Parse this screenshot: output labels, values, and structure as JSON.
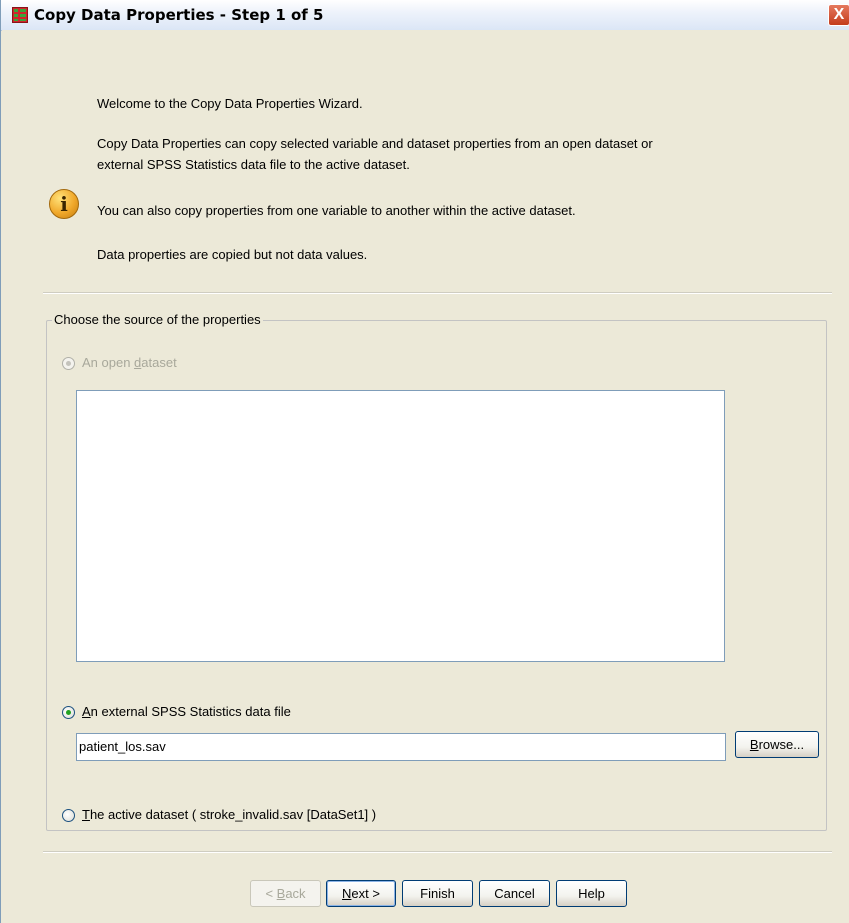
{
  "window": {
    "title": "Copy Data Properties - Step 1 of 5",
    "close_glyph": "X"
  },
  "intro": {
    "welcome": "Welcome to the Copy Data Properties Wizard.",
    "description_line1": "Copy Data Properties can copy selected variable and dataset properties from an open dataset or",
    "description_line2": "external SPSS  Statistics data file to the active dataset.",
    "also_copy": "You can also copy properties from one variable to another within the active dataset.",
    "note": "Data properties are copied but not data values.",
    "info_icon": "info-icon"
  },
  "source_group": {
    "label": "Choose the source of the properties",
    "option_open_dataset": {
      "label_pre": "An open ",
      "label_key": "d",
      "label_post": "ataset",
      "checked": false,
      "enabled": false
    },
    "open_dataset_list": [],
    "option_external_file": {
      "label_key": "A",
      "label_post": "n external SPSS  Statistics data file",
      "checked": true,
      "enabled": true
    },
    "file_path": "patient_los.sav",
    "browse_pre": "",
    "browse_key": "B",
    "browse_post": "rowse...",
    "option_active_dataset": {
      "label_key": "T",
      "label_post": "he active dataset ( stroke_invalid.sav [DataSet1] )",
      "checked": false,
      "enabled": true
    }
  },
  "footer": {
    "back": {
      "pre": "< ",
      "key": "B",
      "post": "ack",
      "enabled": false
    },
    "next": {
      "key": "N",
      "post": "ext >",
      "enabled": true
    },
    "finish": "Finish",
    "cancel": "Cancel",
    "help": "Help"
  },
  "colors": {
    "dialog_bg": "#ece9d8",
    "radio_check": "#21a121",
    "button_border": "#003c74"
  }
}
